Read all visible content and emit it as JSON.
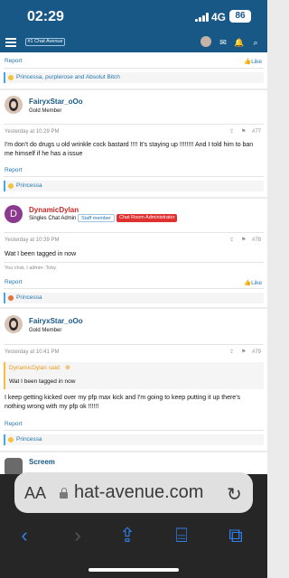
{
  "status_bar": {
    "time": "02:29",
    "network": "4G",
    "battery": "86"
  },
  "nav": {
    "logo_text": "#1 Chat Avenue"
  },
  "colors": {
    "brand": "#185886",
    "link": "#2577b1",
    "staff": "#e03030",
    "accent_bar": "#47a7eb"
  },
  "post_top": {
    "report": "Report",
    "like": "Like",
    "reactions": "Princessa, purplerose and Absolut Bitch"
  },
  "post77": {
    "username": "FairyxStar_oOo",
    "title": "Gold Member",
    "date": "Yesterday at 10:29 PM",
    "number": "#77",
    "body": "I'm don't do drugs u old wrinkle cock bastard !!!! It's staying up !!!!!!!! And I told him to ban me himself if he has a issue",
    "report": "Report",
    "reactions": "Princessa"
  },
  "post78": {
    "avatar_letter": "D",
    "username": "DynamicDylan",
    "title": "Singles Chat Admin",
    "badge_staff": "Staff member",
    "badge_admin": "Chat Room Administrator",
    "date": "Yesterday at 10:39 PM",
    "number": "#78",
    "body": "Wat I been tagged in now",
    "signature": "You chat, I admin- Toby",
    "report": "Report",
    "like": "Like",
    "reactions": "Princessa"
  },
  "post79": {
    "username": "FairyxStar_oOo",
    "title": "Gold Member",
    "date": "Yesterday at 10:41 PM",
    "number": "#79",
    "quote_author": "DynamicDylan said:",
    "quote_text": "Wat I been tagged in now",
    "body": "I keep getting kicked over my pfp max kick and I'm going to keep putting it up there's nothing wrong with my pfp ok !!!!!!",
    "report": "Report",
    "reactions": "Princessa"
  },
  "post80": {
    "username": "Screem"
  },
  "safari": {
    "aa": "AA",
    "url": "hat-avenue.com"
  }
}
